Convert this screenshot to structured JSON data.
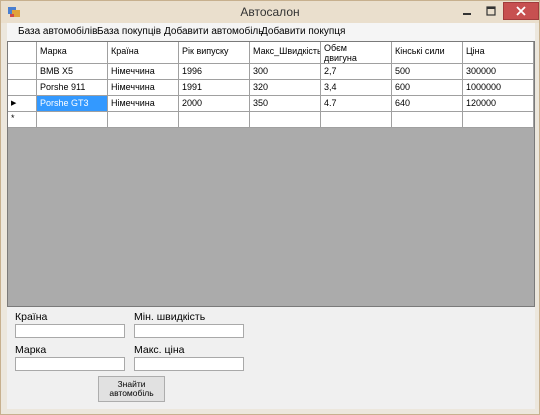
{
  "window": {
    "title": "Автосалон",
    "close_color": "#c75050"
  },
  "menu": [
    {
      "label": "База автомобілів"
    },
    {
      "label": "База покупців"
    },
    {
      "label": "Добавити автомобіль"
    },
    {
      "label": "Добавити покупця"
    }
  ],
  "grid": {
    "columns": [
      {
        "label": "Марка"
      },
      {
        "label": "Країна"
      },
      {
        "label": "Рік випуску"
      },
      {
        "label": "Макс_Швидкість"
      },
      {
        "label": "Обєм двигуна"
      },
      {
        "label": "Кінські сили"
      },
      {
        "label": "Ціна"
      }
    ],
    "rows": [
      {
        "cells": [
          "BMB X5",
          "Німеччина",
          "1996",
          "300",
          "2,7",
          "500",
          "300000"
        ]
      },
      {
        "cells": [
          "Porshe 911",
          "Німеччина",
          "1991",
          "320",
          "3,4",
          "600",
          "1000000"
        ]
      },
      {
        "cells": [
          "Porshe GT3",
          "Німеччина",
          "2000",
          "350",
          "4.7",
          "640",
          "120000"
        ]
      }
    ],
    "new_row_marker": "*",
    "current_row_marker": "▶",
    "selected_color": "#3399ff",
    "empty_area_color": "#ababab"
  },
  "search": {
    "country_label": "Країна",
    "country_value": "",
    "min_speed_label": "Мін. швидкість",
    "min_speed_value": "",
    "brand_label": "Марка",
    "brand_value": "",
    "max_price_label": "Макс. ціна",
    "max_price_value": "",
    "find_button": "Знайти автомобіль"
  }
}
